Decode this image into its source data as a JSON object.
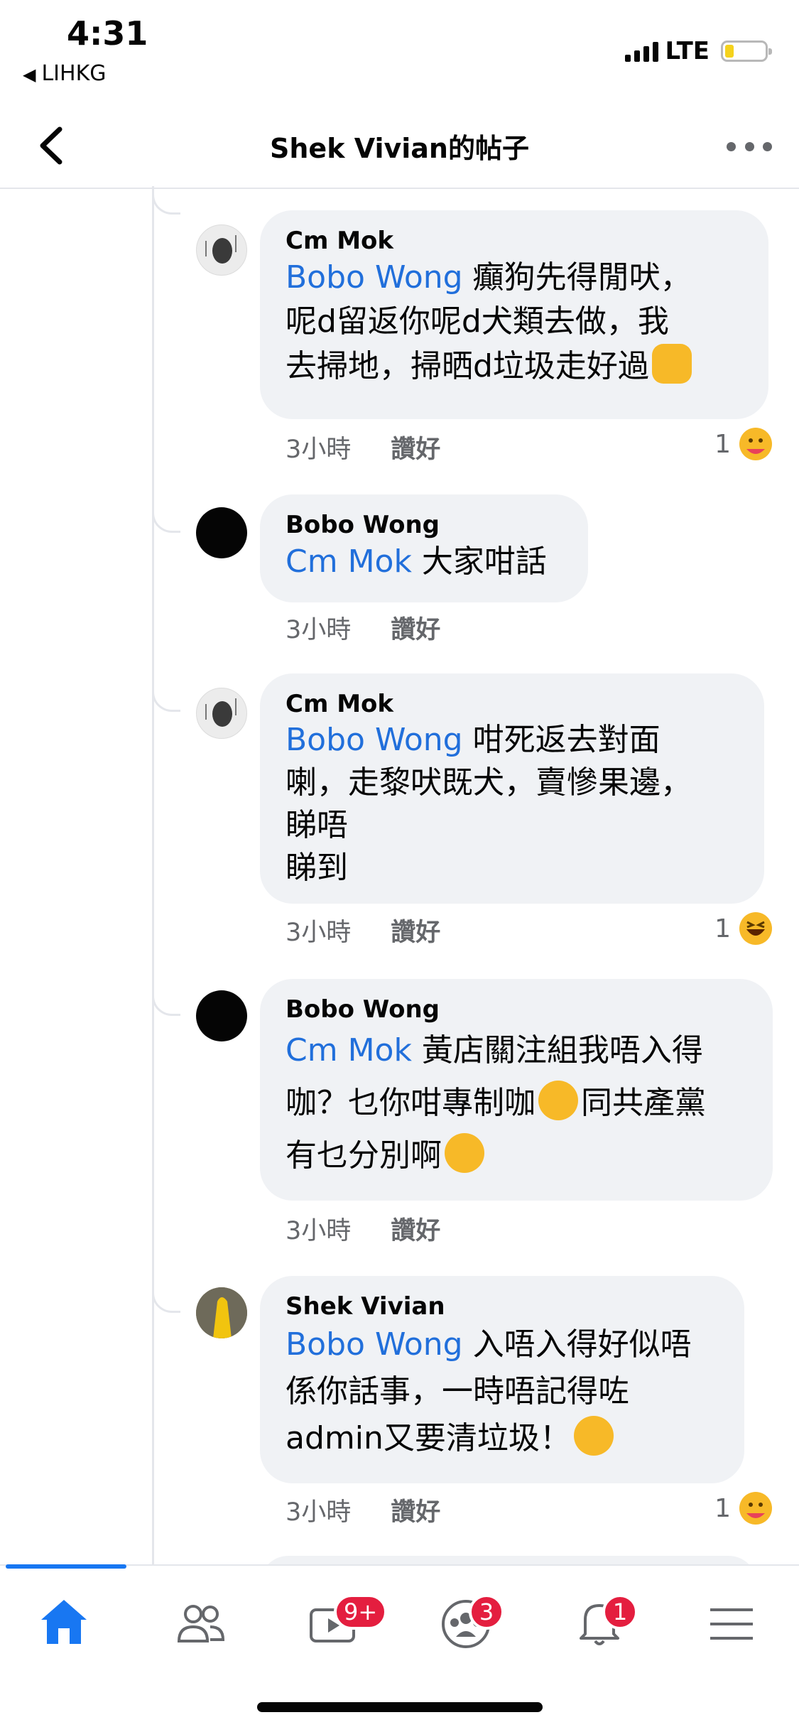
{
  "status_bar": {
    "time": "4:31",
    "back_app": "LIHKG",
    "network": "LTE"
  },
  "header": {
    "title": "Shek Vivian的帖子"
  },
  "comments": [
    {
      "author": "Cm Mok",
      "tag": "Bobo Wong",
      "lines": [
        " 癲狗先得閒吠，",
        "呢d留返你呢d犬類去做，我",
        "去掃地，掃晒d垃圾走好過"
      ],
      "time": "3小時",
      "like": "讚好",
      "reaction_count": "1",
      "avatar": "egg",
      "reaction_icon": "care-emoji"
    },
    {
      "author": "Bobo Wong",
      "tag": "Cm Mok",
      "lines": [
        " 大家咁話"
      ],
      "time": "3小時",
      "like": "讚好",
      "avatar": "black"
    },
    {
      "author": "Cm Mok",
      "tag": "Bobo Wong",
      "lines": [
        " 咁死返去對面",
        "喇，走黎吠既犬，賣慘果邊，",
        "睇唔",
        "睇到"
      ],
      "time": "3小時",
      "like": "讚好",
      "reaction_count": "1",
      "avatar": "egg",
      "reaction_icon": "haha-emoji"
    },
    {
      "author": "Bobo Wong",
      "tag": "Cm Mok",
      "lines": [
        " 黃店關注組我唔入得",
        "咖？乜你咁專制咖",
        "同共產黨",
        "有乜分別啊"
      ],
      "time": "3小時",
      "like": "讚好",
      "avatar": "black"
    },
    {
      "author": "Shek Vivian",
      "tag": "Bobo Wong",
      "lines": [
        " 入唔入得好似唔",
        "係你話事，一時唔記得咗",
        "admin又要清垃圾！"
      ],
      "time": "3小時",
      "like": "讚好",
      "reaction_count": "1",
      "avatar": "yellow",
      "reaction_icon": "care-emoji"
    }
  ],
  "tabbar": {
    "items": [
      {
        "name": "home",
        "icon": "home-icon"
      },
      {
        "name": "friends",
        "icon": "friends-icon"
      },
      {
        "name": "watch",
        "icon": "video-icon",
        "badge": "9+"
      },
      {
        "name": "groups",
        "icon": "groups-icon",
        "badge": "3"
      },
      {
        "name": "notifications",
        "icon": "bell-icon",
        "badge": "1"
      },
      {
        "name": "menu",
        "icon": "menu-icon"
      }
    ]
  },
  "colors": {
    "tag": "#216fdb",
    "accent": "#1877f2",
    "badge": "#e41e3f",
    "bubble": "#f0f2f5"
  }
}
